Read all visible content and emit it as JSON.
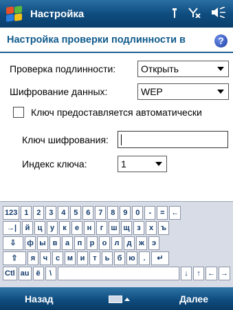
{
  "titlebar": {
    "title": "Настройка",
    "icons": [
      "start-logo",
      "signal-antenna-icon",
      "network-off-icon",
      "volume-icon"
    ]
  },
  "header": {
    "title": "Настройка проверки подлинности в",
    "help_icon": "?"
  },
  "form": {
    "auth_label": "Проверка подлинности:",
    "auth_value": "Открыть",
    "encryption_label": "Шифрование данных:",
    "encryption_value": "WEP",
    "auto_key_label": "Ключ предоставляется автоматически",
    "auto_key_checked": false,
    "network_key_label": "Ключ шифрования:",
    "network_key_value": "",
    "key_index_label": "Индекс ключа:",
    "key_index_value": "1"
  },
  "keyboard": {
    "rows": [
      [
        "123",
        "1",
        "2",
        "3",
        "4",
        "5",
        "6",
        "7",
        "8",
        "9",
        "0",
        "-",
        "=",
        "←"
      ],
      [
        "→|",
        "й",
        "ц",
        "у",
        "к",
        "е",
        "н",
        "г",
        "ш",
        "щ",
        "з",
        "х",
        "ъ"
      ],
      [
        "⇩",
        "ф",
        "ы",
        "в",
        "а",
        "п",
        "р",
        "о",
        "л",
        "д",
        "ж",
        "э"
      ],
      [
        "⇧",
        "я",
        "ч",
        "с",
        "м",
        "и",
        "т",
        "ь",
        "б",
        "ю",
        ".",
        "↵"
      ],
      [
        "Ctl",
        "au",
        "ё",
        "\\",
        " ",
        "↓",
        "↑",
        "←",
        "→"
      ]
    ]
  },
  "bottombar": {
    "left_label": "Назад",
    "right_label": "Далее",
    "input_icon": "keyboard-icon"
  }
}
